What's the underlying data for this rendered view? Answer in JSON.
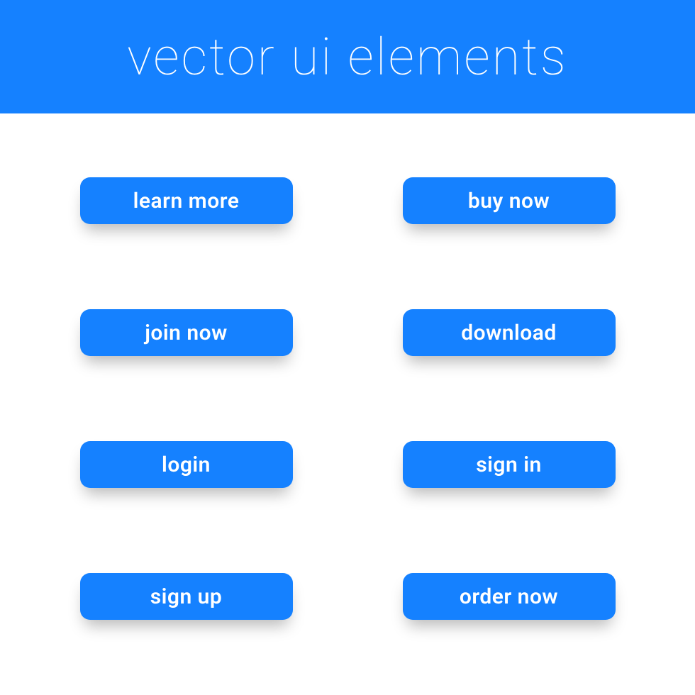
{
  "header": {
    "title": "vector ui elements"
  },
  "colors": {
    "accent": "#1581ff",
    "text": "#ffffff"
  },
  "buttons": {
    "learn_more": "learn more",
    "buy_now": "buy now",
    "join_now": "join now",
    "download": "download",
    "login": "login",
    "sign_in": "sign in",
    "sign_up": "sign up",
    "order_now": "order now"
  }
}
